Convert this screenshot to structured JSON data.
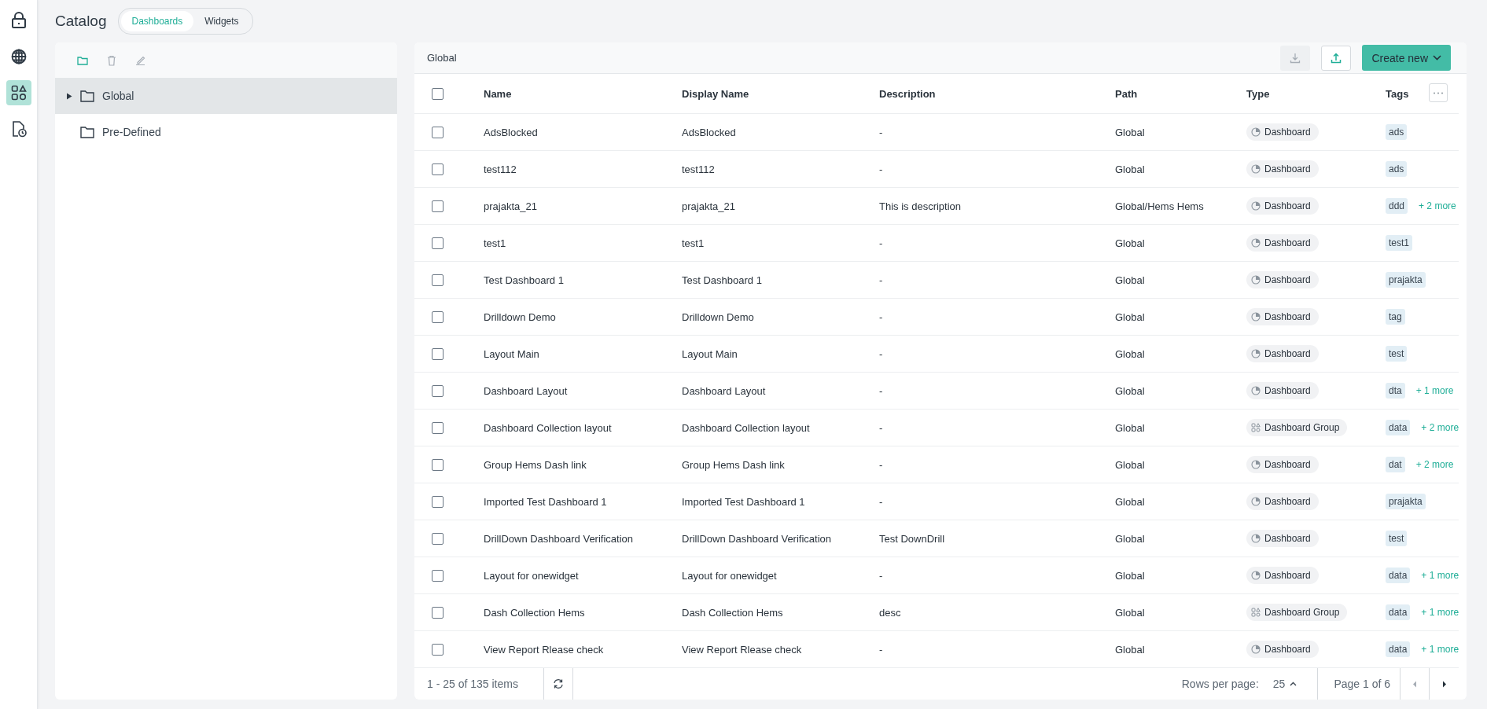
{
  "nav": [
    {
      "kind": "lock",
      "selected": false
    },
    {
      "kind": "globe",
      "selected": false
    },
    {
      "kind": "shapes",
      "selected": true
    },
    {
      "kind": "doc-clock",
      "selected": false
    }
  ],
  "title": "Catalog",
  "tabs": [
    {
      "label": "Dashboards",
      "selected": true
    },
    {
      "label": "Widgets",
      "selected": false
    }
  ],
  "tree": [
    {
      "label": "Global",
      "selected": true,
      "expandable": true
    },
    {
      "label": "Pre-Defined",
      "selected": false,
      "expandable": false
    }
  ],
  "panel_title": "Global",
  "toolbar": {
    "download_disabled": true,
    "create_label": "Create new"
  },
  "select_all_checked": false,
  "columns": [
    "Name",
    "Display Name",
    "Description",
    "Path",
    "Type",
    "Tags"
  ],
  "rows": [
    {
      "checked": false,
      "name": "AdsBlocked",
      "display_name": "AdsBlocked",
      "description": "-",
      "path": "Global",
      "type": {
        "kind": "dashboard",
        "label": "Dashboard"
      },
      "tag": "ads"
    },
    {
      "checked": false,
      "name": "test112",
      "display_name": "test112",
      "description": "-",
      "path": "Global",
      "type": {
        "kind": "dashboard",
        "label": "Dashboard"
      },
      "tag": "ads"
    },
    {
      "checked": false,
      "name": "prajakta_21",
      "display_name": "prajakta_21",
      "description": "This is description",
      "path": "Global/Hems Hems",
      "type": {
        "kind": "dashboard",
        "label": "Dashboard"
      },
      "tag": "ddd",
      "more": "+ 2 more"
    },
    {
      "checked": false,
      "name": "test1",
      "display_name": "test1",
      "description": "-",
      "path": "Global",
      "type": {
        "kind": "dashboard",
        "label": "Dashboard"
      },
      "tag": "test1"
    },
    {
      "checked": false,
      "name": "Test Dashboard 1",
      "display_name": "Test Dashboard 1",
      "description": "-",
      "path": "Global",
      "type": {
        "kind": "dashboard",
        "label": "Dashboard"
      },
      "tag": "prajakta"
    },
    {
      "checked": false,
      "name": "Drilldown Demo",
      "display_name": "Drilldown Demo",
      "description": "-",
      "path": "Global",
      "type": {
        "kind": "dashboard",
        "label": "Dashboard"
      },
      "tag": "tag"
    },
    {
      "checked": false,
      "name": "Layout Main",
      "display_name": "Layout Main",
      "description": "-",
      "path": "Global",
      "type": {
        "kind": "dashboard",
        "label": "Dashboard"
      },
      "tag": "test"
    },
    {
      "checked": false,
      "name": "Dashboard Layout",
      "display_name": "Dashboard Layout",
      "description": "-",
      "path": "Global",
      "type": {
        "kind": "dashboard",
        "label": "Dashboard"
      },
      "tag": "dta",
      "more": "+ 1 more"
    },
    {
      "checked": false,
      "name": "Dashboard Collection layout",
      "display_name": "Dashboard Collection layout",
      "description": "-",
      "path": "Global",
      "type": {
        "kind": "group",
        "label": "Dashboard Group"
      },
      "tag": "data",
      "more": "+ 2 more"
    },
    {
      "checked": false,
      "name": "Group Hems Dash link",
      "display_name": "Group Hems Dash link",
      "description": "-",
      "path": "Global",
      "type": {
        "kind": "dashboard",
        "label": "Dashboard"
      },
      "tag": "dat",
      "more": "+ 2 more"
    },
    {
      "checked": false,
      "name": "Imported Test Dashboard 1",
      "display_name": "Imported Test Dashboard 1",
      "description": "-",
      "path": "Global",
      "type": {
        "kind": "dashboard",
        "label": "Dashboard"
      },
      "tag": "prajakta"
    },
    {
      "checked": false,
      "name": "DrillDown Dashboard Verification",
      "display_name": "DrillDown Dashboard Verification",
      "description": "Test DownDrill",
      "path": "Global",
      "type": {
        "kind": "dashboard",
        "label": "Dashboard"
      },
      "tag": "test"
    },
    {
      "checked": false,
      "name": "Layout for onewidget",
      "display_name": "Layout for onewidget",
      "description": "-",
      "path": "Global",
      "type": {
        "kind": "dashboard",
        "label": "Dashboard"
      },
      "tag": "data",
      "more": "+ 1 more"
    },
    {
      "checked": false,
      "name": "Dash Collection Hems",
      "display_name": "Dash Collection Hems",
      "description": "desc",
      "path": "Global",
      "type": {
        "kind": "group",
        "label": "Dashboard Group"
      },
      "tag": "data",
      "more": "+ 1 more"
    },
    {
      "checked": false,
      "name": "View Report Rlease check",
      "display_name": "View Report Rlease check",
      "description": "-",
      "path": "Global",
      "type": {
        "kind": "dashboard",
        "label": "Dashboard"
      },
      "tag": "data",
      "more": "+ 1 more"
    }
  ],
  "footer": {
    "items": "1 - 25 of 135 items",
    "rows_label": "Rows per page:",
    "rows_value": "25",
    "page": "Page 1 of 6",
    "prev_disabled": true
  }
}
